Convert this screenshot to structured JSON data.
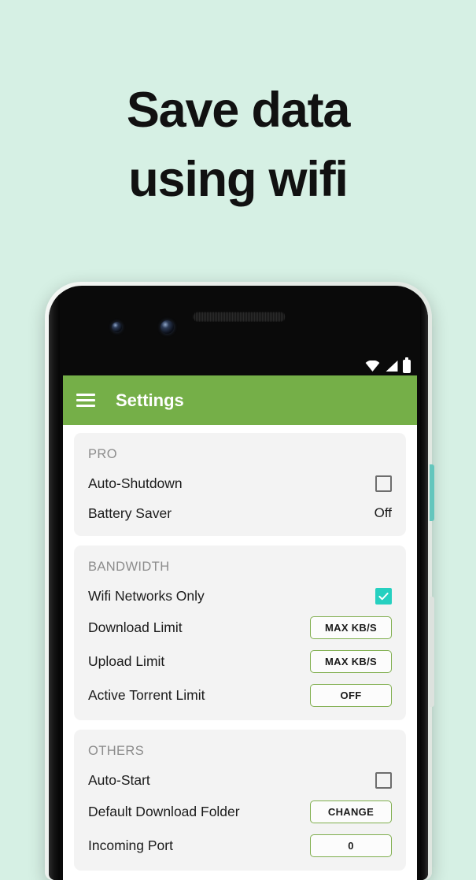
{
  "theme": {
    "background": "#d6f0e4",
    "appbar_green": "#75af48",
    "accent_teal": "#26d0c0",
    "button_border_green": "#7fae4d",
    "card_gray": "#f3f3f3"
  },
  "headline": {
    "line1": "Save data",
    "line2": "using wifi"
  },
  "phone": {
    "status_icons": [
      "wifi-icon",
      "signal-icon",
      "battery-icon"
    ],
    "side_buttons": [
      "teal-side-button",
      "gray-side-button"
    ],
    "hardware": [
      "earpiece-speaker",
      "front-camera-1",
      "front-camera-2"
    ]
  },
  "appbar": {
    "menu_icon": "hamburger-menu-icon",
    "title": "Settings"
  },
  "sections": [
    {
      "header": "PRO",
      "rows": [
        {
          "label": "Auto-Shutdown",
          "control": "checkbox",
          "checked": false
        },
        {
          "label": "Battery Saver",
          "control": "text",
          "value": "Off"
        }
      ]
    },
    {
      "header": "BANDWIDTH",
      "rows": [
        {
          "label": "Wifi Networks Only",
          "control": "checkbox",
          "checked": true
        },
        {
          "label": "Download Limit",
          "control": "button",
          "value": "MAX KB/S"
        },
        {
          "label": "Upload Limit",
          "control": "button",
          "value": "MAX KB/S"
        },
        {
          "label": "Active Torrent Limit",
          "control": "button",
          "value": "OFF"
        }
      ]
    },
    {
      "header": "OTHERS",
      "rows": [
        {
          "label": "Auto-Start",
          "control": "checkbox",
          "checked": false
        },
        {
          "label": "Default Download Folder",
          "control": "button",
          "value": "CHANGE"
        },
        {
          "label": "Incoming Port",
          "control": "button",
          "value": "0"
        }
      ]
    }
  ]
}
